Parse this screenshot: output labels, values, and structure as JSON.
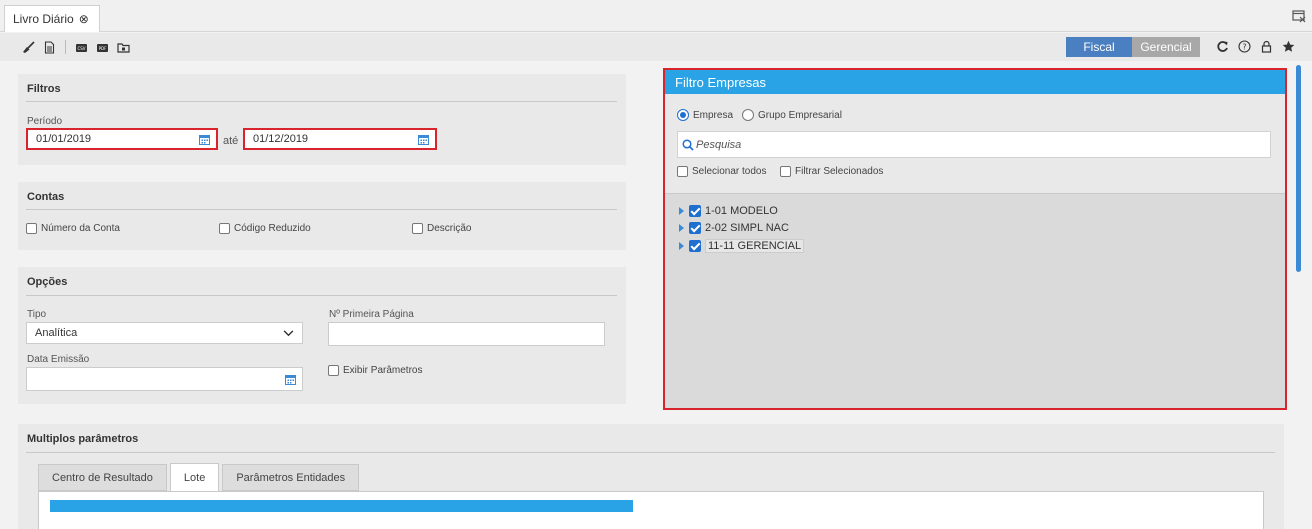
{
  "tab": {
    "title": "Livro Diário",
    "close_icon": "close-circle-icon"
  },
  "toolbar": {
    "left_icons": [
      "broom-icon",
      "document-icon",
      "export-csv-icon",
      "export-pdf-icon",
      "folder-icon"
    ],
    "fiscal_label": "Fiscal",
    "gerencial_label": "Gerencial",
    "right_icons": [
      "refresh-icon",
      "help-icon",
      "lock-icon",
      "star-icon"
    ]
  },
  "filtros": {
    "title": "Filtros",
    "periodo_label": "Período",
    "start_date": "01/01/2019",
    "ate_label": "até",
    "end_date": "01/12/2019"
  },
  "contas": {
    "title": "Contas",
    "numero_label": "Número da Conta",
    "codigo_label": "Código Reduzido",
    "descricao_label": "Descrição"
  },
  "opcoes": {
    "title": "Opções",
    "tipo_label": "Tipo",
    "tipo_value": "Analítica",
    "primeira_pagina_label": "Nº Primeira Página",
    "primeira_pagina_value": "",
    "data_emissao_label": "Data Emissão",
    "data_emissao_value": "",
    "exibir_label": "Exibir Parâmetros"
  },
  "filtro_empresas": {
    "title": "Filtro Empresas",
    "empresa_label": "Empresa",
    "grupo_label": "Grupo Empresarial",
    "search_placeholder": "Pesquisa",
    "selecionar_todos_label": "Selecionar todos",
    "filtrar_selecionados_label": "Filtrar Selecionados",
    "items": [
      {
        "label": "1-01 MODELO",
        "checked": true
      },
      {
        "label": "2-02 SIMPL NAC",
        "checked": true
      },
      {
        "label": "11-11 GERENCIAL",
        "checked": true
      }
    ]
  },
  "multiplos": {
    "title": "Multiplos parâmetros",
    "tabs": [
      "Centro de Resultado",
      "Lote",
      "Parâmetros Entidades"
    ],
    "active_tab": "Lote"
  },
  "colors": {
    "accent": "#29a3e6",
    "fiscal": "#4a7fc1",
    "highlight": "#d9232d"
  }
}
